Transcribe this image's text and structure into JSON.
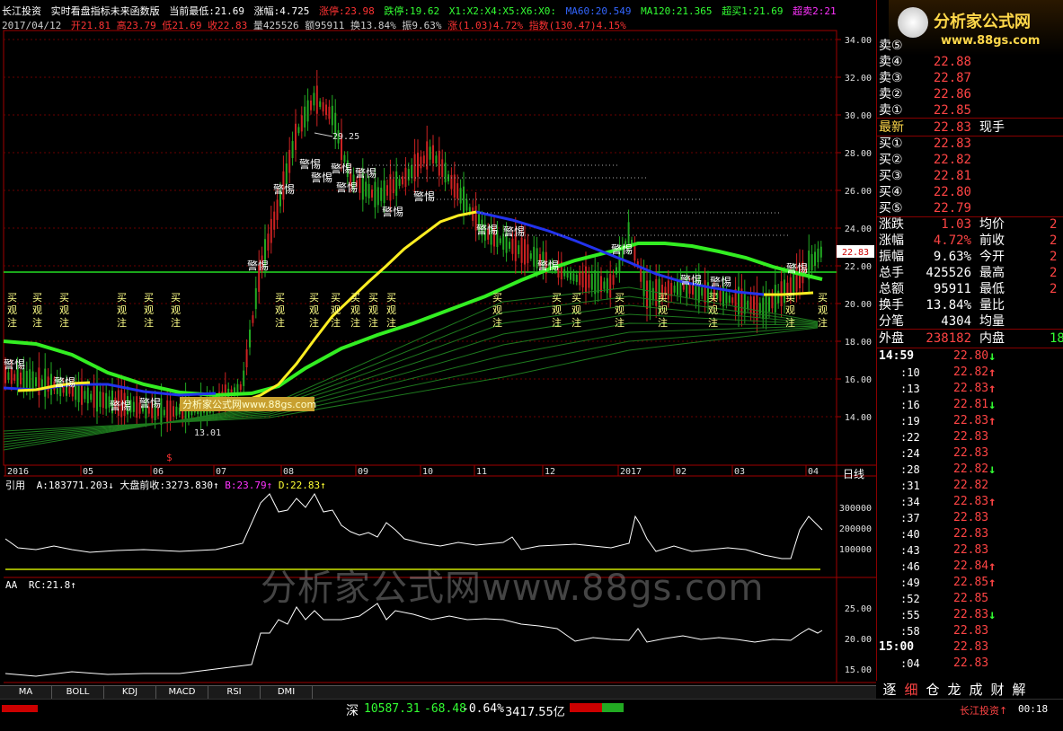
{
  "header": {
    "line1": {
      "stock": "长江投资",
      "indicator": "实时看盘指标未来函数版",
      "low": "当前最低:21.69",
      "amp": "涨幅:4.725",
      "limit_up": "涨停:23.98",
      "limit_down": "跌停:19.62",
      "x_series": "X1:X2:X4:X5:X6:X0:",
      "ma60": "MA60:20.549",
      "ma120": "MA120:21.365",
      "overbuy": "超买1:21.69",
      "oversell": "超卖2:21"
    },
    "line2": {
      "date": "2017/04/12",
      "open": "开21.81",
      "high": "高23.79",
      "low": "低21.69",
      "close": "收22.83",
      "vol": "量425526",
      "amount": "额95911",
      "turnover": "换13.84%",
      "amplitude": "振9.63%",
      "change": "涨(1.03)4.72%",
      "index": "指数(130.47)4.15%"
    }
  },
  "price_axis": [
    "34.00",
    "32.00",
    "30.00",
    "28.00",
    "26.00",
    "24.00",
    "22.00",
    "20.00",
    "18.00",
    "16.00",
    "14.00"
  ],
  "current_price_tag": "22.83",
  "high_annot": "29.25",
  "low_annot": "13.01",
  "date_axis": [
    "2016",
    "05",
    "06",
    "07",
    "08",
    "09",
    "10",
    "11",
    "12",
    "2017",
    "02",
    "03",
    "04"
  ],
  "period_label": "日线",
  "signals": {
    "warn": "警惕",
    "buy": "买观注",
    "dollar": "$"
  },
  "sub1": {
    "title": "引用",
    "a": "A:183771.203↓",
    "prev": "大盘前收:3273.830↑",
    "b": "B:23.79↑",
    "d": "D:22.83↑",
    "axis": [
      "300000",
      "200000",
      "100000"
    ]
  },
  "sub2": {
    "title": "AA",
    "rc": "RC:21.8↑",
    "axis": [
      "25.00",
      "20.00",
      "15.00"
    ]
  },
  "watermark": "分析家公式网www.88gs.com",
  "small_watermark": "分析家公式网www.88gs.com",
  "logo": {
    "title": "分析家公式网",
    "url": "www.88gs.com"
  },
  "quote": {
    "sells": [
      {
        "label": "卖⑤",
        "value": ""
      },
      {
        "label": "卖④",
        "value": "22.88"
      },
      {
        "label": "卖③",
        "value": "22.87"
      },
      {
        "label": "卖②",
        "value": "22.86"
      },
      {
        "label": "卖①",
        "value": "22.85"
      }
    ],
    "latest": {
      "label": "最新",
      "value": "22.83",
      "extra": "现手"
    },
    "buys": [
      {
        "label": "买①",
        "value": "22.83"
      },
      {
        "label": "买②",
        "value": "22.82"
      },
      {
        "label": "买③",
        "value": "22.81"
      },
      {
        "label": "买④",
        "value": "22.80"
      },
      {
        "label": "买⑤",
        "value": "22.79"
      }
    ],
    "stats": [
      {
        "l1": "涨跌",
        "v1": "1.03",
        "l2": "均价",
        "v2": "2"
      },
      {
        "l1": "涨幅",
        "v1": "4.72%",
        "l2": "前收",
        "v2": "2"
      },
      {
        "l1": "振幅",
        "v1": "9.63%",
        "l2": "今开",
        "v2": "2"
      },
      {
        "l1": "总手",
        "v1": "425526",
        "l2": "最高",
        "v2": "2"
      },
      {
        "l1": "总额",
        "v1": "95911",
        "l2": "最低",
        "v2": "2"
      },
      {
        "l1": "换手",
        "v1": "13.84%",
        "l2": "量比",
        "v2": ""
      },
      {
        "l1": "分笔",
        "v1": "4304",
        "l2": "均量",
        "v2": ""
      }
    ],
    "outer": {
      "label": "外盘",
      "value": "238182",
      "label2": "内盘",
      "value2": "18"
    }
  },
  "ticks": [
    {
      "time": "14:59",
      "price": "22.80",
      "dir": "down",
      "bold": true
    },
    {
      "time": ":10",
      "price": "22.82",
      "dir": "up"
    },
    {
      "time": ":13",
      "price": "22.83",
      "dir": "up"
    },
    {
      "time": ":16",
      "price": "22.81",
      "dir": "down"
    },
    {
      "time": ":19",
      "price": "22.83",
      "dir": "up"
    },
    {
      "time": ":22",
      "price": "22.83",
      "dir": ""
    },
    {
      "time": ":24",
      "price": "22.83",
      "dir": ""
    },
    {
      "time": ":28",
      "price": "22.82",
      "dir": "down"
    },
    {
      "time": ":31",
      "price": "22.82",
      "dir": ""
    },
    {
      "time": ":34",
      "price": "22.83",
      "dir": "up"
    },
    {
      "time": ":37",
      "price": "22.83",
      "dir": ""
    },
    {
      "time": ":40",
      "price": "22.83",
      "dir": ""
    },
    {
      "time": ":43",
      "price": "22.83",
      "dir": ""
    },
    {
      "time": ":46",
      "price": "22.84",
      "dir": "up"
    },
    {
      "time": ":49",
      "price": "22.85",
      "dir": "up"
    },
    {
      "time": ":52",
      "price": "22.85",
      "dir": ""
    },
    {
      "time": ":55",
      "price": "22.83",
      "dir": "down"
    },
    {
      "time": ":58",
      "price": "22.83",
      "dir": ""
    },
    {
      "time": "15:00",
      "price": "22.83",
      "dir": "",
      "bold": true
    },
    {
      "time": ":04",
      "price": "22.83",
      "dir": ""
    }
  ],
  "bottom_tabs": [
    "MA",
    "BOLL",
    "KDJ",
    "MACD",
    "RSI",
    "DMI"
  ],
  "right_tabs": [
    "逐",
    "细",
    "仓",
    "龙",
    "成",
    "财",
    "解"
  ],
  "status": {
    "market": "深",
    "index": "10587.31",
    "change": "-68.48",
    "pct": "-0.64%",
    "amount": "3417.55亿",
    "broker": "长江投资↑",
    "time": "00:18"
  }
}
